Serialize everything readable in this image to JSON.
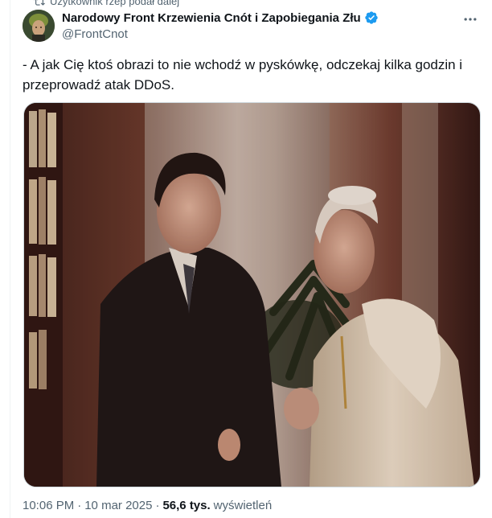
{
  "repost": {
    "text": "Użytkownik rzep podał dalej"
  },
  "author": {
    "name": "Narodowy Front Krzewienia Cnót i Zapobiegania Złu",
    "handle": "@FrontCnot"
  },
  "tweet": {
    "text": "- A jak Cię ktoś obrazi to nie wchodź w pyskówkę, odczekaj kilka godzin i przeprowadź atak DDoS."
  },
  "meta": {
    "time": "10:06 PM",
    "separator": "·",
    "date": "10 mar 2025",
    "views_count": "56,6 tys.",
    "views_label": "wyświetleń"
  },
  "colors": {
    "verified": "#1d9bf0",
    "text": "#0f1419",
    "secondary": "#536471"
  },
  "icons": {
    "repost": "repost-icon",
    "verified": "verified-badge-icon",
    "more": "more-icon"
  }
}
